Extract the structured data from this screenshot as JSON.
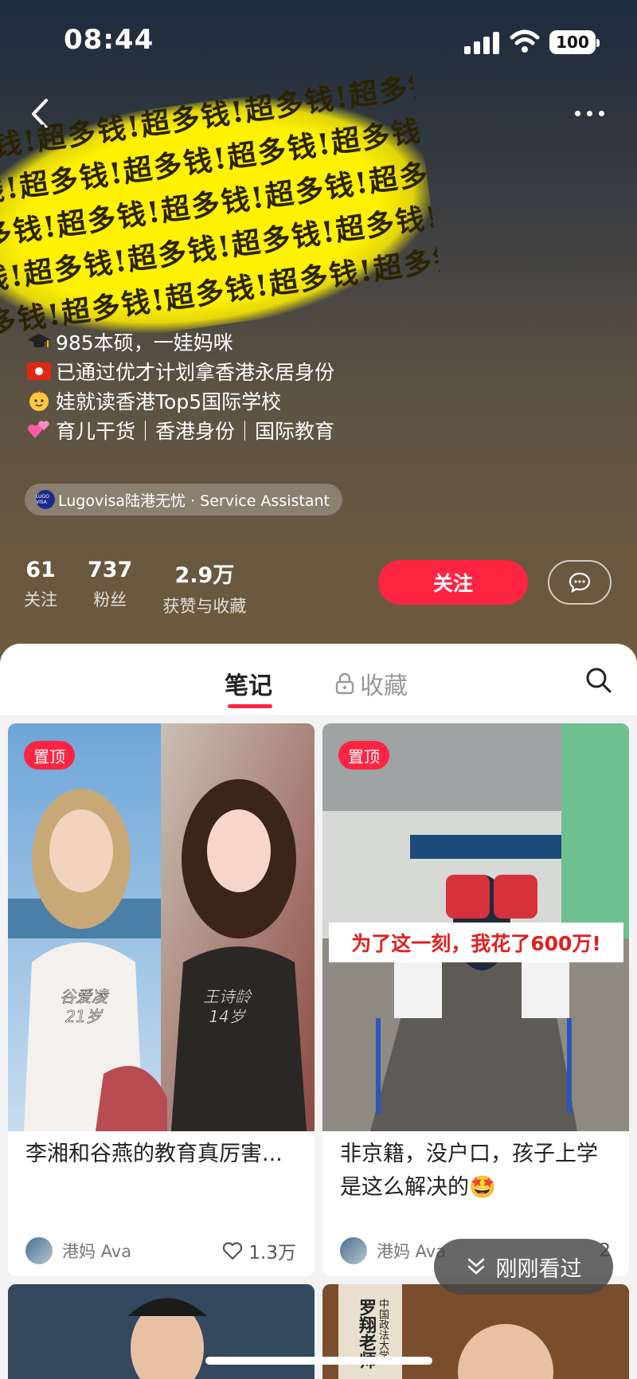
{
  "status_bar": {
    "time": "08:44",
    "battery": "100"
  },
  "banner": {
    "text": "超多钱!超多钱!超多钱!超多钱!超多钱!超多钱!"
  },
  "bio": [
    {
      "emoji": "graduation-cap",
      "text": "985本硕，一娃妈咪"
    },
    {
      "emoji": "hong-kong-flag",
      "text": "已通过优才计划拿香港永居身份"
    },
    {
      "emoji": "baby",
      "text": "娃就读香港Top5国际学校"
    },
    {
      "emoji": "two-hearts",
      "text": "育儿干货｜香港身份｜国际教育"
    }
  ],
  "tag": {
    "logo_text": "LUGO VISA",
    "label": "Lugovisa陆港无忧 · Service Assistant"
  },
  "stats": [
    {
      "num": "61",
      "label": "关注"
    },
    {
      "num": "737",
      "label": "粉丝"
    },
    {
      "num": "2.9万",
      "label": "获赞与收藏"
    }
  ],
  "actions": {
    "follow": "关注"
  },
  "tabs": {
    "notes": "笔记",
    "favorites": "收藏"
  },
  "cards": [
    {
      "pin": "置顶",
      "title": "李湘和谷燕的教育真厉害...",
      "author": "港妈 Ava",
      "likes": "1.3万",
      "overlay_left": "谷爱凌",
      "overlay_left_age": "21岁",
      "overlay_right": "王诗龄",
      "overlay_right_age": "14岁"
    },
    {
      "pin": "置顶",
      "title": "非京籍，没户口，孩子上学是这么解决的🤩",
      "author": "港妈 Ava",
      "likes": "2",
      "overlay_caption": "为了这一刻，我花了600万!"
    }
  ],
  "peek_card": {
    "text_vertical": "罗翔老师",
    "sub": "中国政法大学"
  },
  "recent": "刚刚看过",
  "colors": {
    "accent": "#ff2442",
    "banner_yellow": "#fff200"
  }
}
